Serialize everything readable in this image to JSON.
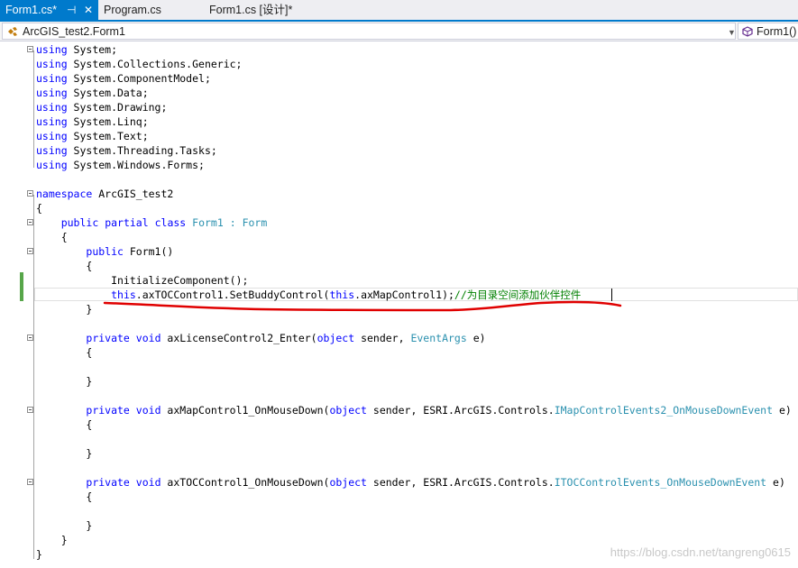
{
  "tabs": [
    {
      "label": "Form1.cs*",
      "active": true,
      "pin": "⊣",
      "close": "✕"
    },
    {
      "label": "Program.cs",
      "active": false
    },
    {
      "label": "Form1.cs [设计]*",
      "active": false
    }
  ],
  "nav": {
    "class_selector": "ArcGIS_test2.Form1",
    "member_selector": "Form1()"
  },
  "code": {
    "l0": [
      "using",
      " System;"
    ],
    "l1": [
      "using",
      " System.Collections.Generic;"
    ],
    "l2": [
      "using",
      " System.ComponentModel;"
    ],
    "l3": [
      "using",
      " System.Data;"
    ],
    "l4": [
      "using",
      " System.Drawing;"
    ],
    "l5": [
      "using",
      " System.Linq;"
    ],
    "l6": [
      "using",
      " System.Text;"
    ],
    "l7": [
      "using",
      " System.Threading.Tasks;"
    ],
    "l8": [
      "using",
      " System.Windows.Forms;"
    ],
    "l10": [
      "namespace",
      " ArcGIS_test2"
    ],
    "l11": [
      "{"
    ],
    "l12": [
      "    ",
      "public",
      " ",
      "partial",
      " ",
      "class",
      " ",
      "Form1",
      " : ",
      "Form"
    ],
    "l13": [
      "    {"
    ],
    "l14": [
      "        ",
      "public",
      " Form1()"
    ],
    "l15": [
      "        {"
    ],
    "l16": [
      "            InitializeComponent();"
    ],
    "l17": [
      "            ",
      "this",
      ".axTOCControl1.SetBuddyControl(",
      "this",
      ".axMapControl1);",
      "//为目录空间添加伙伴控件"
    ],
    "l18": [
      "        }"
    ],
    "l20": [
      "        ",
      "private",
      " ",
      "void",
      " axLicenseControl2_Enter(",
      "object",
      " sender, ",
      "EventArgs",
      " e)"
    ],
    "l21": [
      "        {"
    ],
    "l23": [
      "        }"
    ],
    "l25": [
      "        ",
      "private",
      " ",
      "void",
      " axMapControl1_OnMouseDown(",
      "object",
      " sender, ESRI.ArcGIS.Controls.",
      "IMapControlEvents2_OnMouseDownEvent",
      " e)"
    ],
    "l26": [
      "        {"
    ],
    "l28": [
      "        }"
    ],
    "l30": [
      "        ",
      "private",
      " ",
      "void",
      " axTOCControl1_OnMouseDown(",
      "object",
      " sender, ESRI.ArcGIS.Controls.",
      "ITOCControlEvents_OnMouseDownEvent",
      " e)"
    ],
    "l31": [
      "        {"
    ],
    "l33": [
      "        }"
    ],
    "l34": [
      "    }"
    ],
    "l35": [
      "}"
    ]
  },
  "watermark": "https://blog.csdn.net/tangreng0615",
  "colors": {
    "keyword": "#0000ff",
    "type": "#2b91af",
    "comment": "#008000",
    "tab_active": "#007acc",
    "annotation": "#e00000"
  }
}
